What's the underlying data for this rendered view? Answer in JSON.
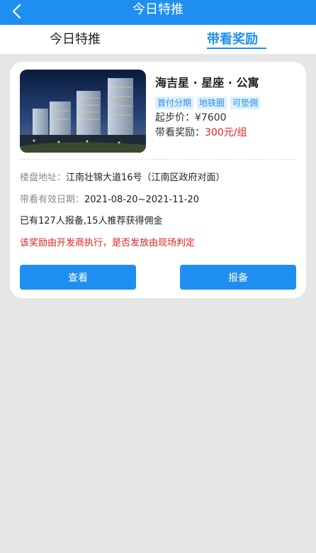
{
  "header": {
    "title": "今日特推",
    "back_icon": "chevron-left-icon"
  },
  "tabs": [
    {
      "label": "今日特推",
      "active": false
    },
    {
      "label": "带看奖励",
      "active": true
    }
  ],
  "listing": {
    "name": "海吉星 · 星座 · 公寓",
    "tags": [
      "首付分期",
      "地铁圈",
      "可垫佣"
    ],
    "price_label": "起步价：",
    "price_value": "¥7600",
    "reward_label": "带看奖励：",
    "reward_value": "300元/组",
    "address_label": "楼盘地址：",
    "address_value": "江南壮锦大道16号（江南区政府对面）",
    "validity_label": "带看有效日期：",
    "validity_value": "2021-08-20~2021-11-20",
    "stats": "已有127人报备,15人推荐获得佣金",
    "notice": "该奖励由开发商执行，是否发放由现场判定",
    "view_button": "查看",
    "report_button": "报备"
  },
  "colors": {
    "primary": "#1f8ef1",
    "danger": "#e02020",
    "background": "#e6e6e6"
  }
}
